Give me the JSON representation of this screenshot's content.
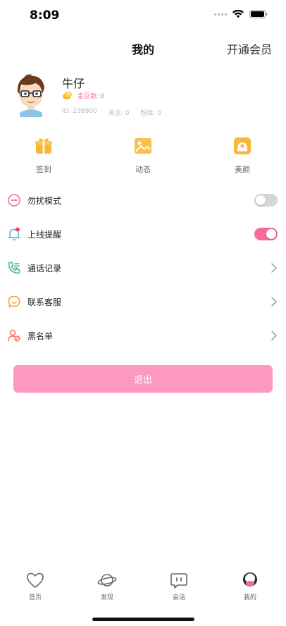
{
  "status_bar": {
    "time": "8:09"
  },
  "nav": {
    "title": "我的",
    "vip_label": "开通会员"
  },
  "profile": {
    "name": "牛仔",
    "coin_label": "金豆数:",
    "coin_value": "0",
    "id_text": "ID: 238900",
    "follow_text": "关注: 0",
    "fans_text": "粉丝: 0"
  },
  "shortcuts": [
    {
      "label": "签到",
      "icon": "gift-icon"
    },
    {
      "label": "动态",
      "icon": "image-icon"
    },
    {
      "label": "美颜",
      "icon": "beauty-icon"
    }
  ],
  "menu": [
    {
      "label": "勿扰模式",
      "icon": "minus-circle-icon",
      "control": "toggle",
      "on": false
    },
    {
      "label": "上线提醒",
      "icon": "bell-icon",
      "control": "toggle",
      "on": true
    },
    {
      "label": "通话记录",
      "icon": "phone-icon",
      "control": "chevron"
    },
    {
      "label": "联系客服",
      "icon": "chat-icon",
      "control": "chevron"
    },
    {
      "label": "黑名单",
      "icon": "user-block-icon",
      "control": "chevron"
    }
  ],
  "logout_label": "退出",
  "tabs": [
    {
      "label": "首页",
      "icon": "heart-icon",
      "active": false
    },
    {
      "label": "发现",
      "icon": "planet-icon",
      "active": false
    },
    {
      "label": "会话",
      "icon": "message-icon",
      "active": false
    },
    {
      "label": "我的",
      "icon": "profile-icon",
      "active": true
    }
  ],
  "colors": {
    "accent": "#f36d9b",
    "button": "#fd98c1",
    "gold": "#f7b733"
  }
}
